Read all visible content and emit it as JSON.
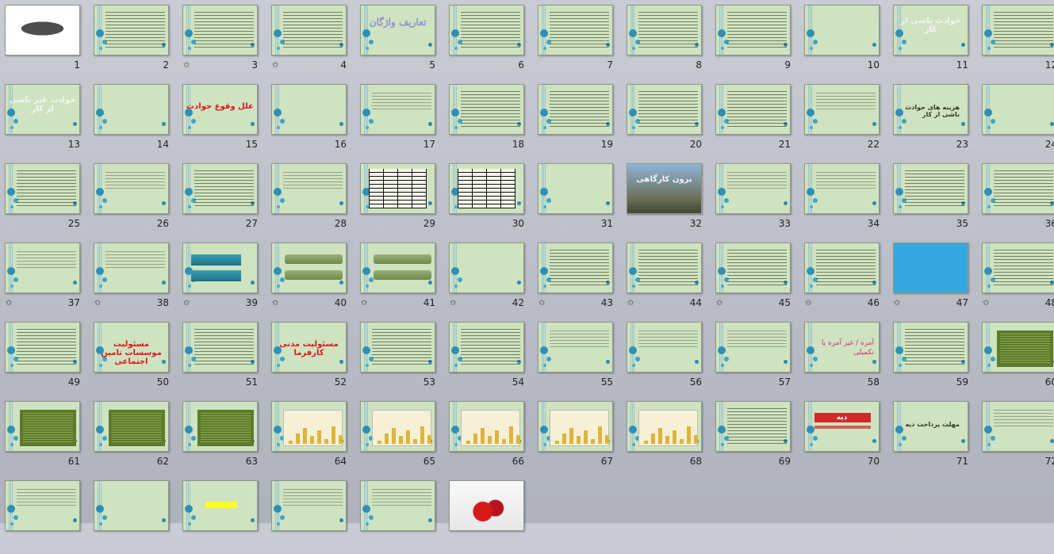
{
  "slides": [
    {
      "n": "1",
      "star": "",
      "v": "cal"
    },
    {
      "n": "2",
      "star": "",
      "v": "lines"
    },
    {
      "n": "3",
      "star": "✩",
      "v": "lines"
    },
    {
      "n": "4",
      "star": "✩",
      "v": "lines"
    },
    {
      "n": "5",
      "star": "",
      "v": "title",
      "title": "تعاریف واژگان"
    },
    {
      "n": "6",
      "star": "",
      "v": "lines"
    },
    {
      "n": "7",
      "star": "",
      "v": "lines"
    },
    {
      "n": "8",
      "star": "",
      "v": "lines"
    },
    {
      "n": "9",
      "star": "",
      "v": "lines"
    },
    {
      "n": "10",
      "star": "",
      "v": "plain"
    },
    {
      "n": "11",
      "star": "",
      "v": "white",
      "title": "حوادث ناشی از کار"
    },
    {
      "n": "12",
      "star": "",
      "v": "lines"
    },
    {
      "n": "13",
      "star": "",
      "v": "white",
      "title": "حوادث غیر ناشی از کار"
    },
    {
      "n": "14",
      "star": "",
      "v": "plain"
    },
    {
      "n": "15",
      "star": "",
      "v": "red",
      "title": "علل وقوع حوادث"
    },
    {
      "n": "16",
      "star": "",
      "v": "plain"
    },
    {
      "n": "17",
      "star": "",
      "v": "sparse"
    },
    {
      "n": "18",
      "star": "",
      "v": "lines"
    },
    {
      "n": "19",
      "star": "",
      "v": "lines"
    },
    {
      "n": "20",
      "star": "",
      "v": "lines"
    },
    {
      "n": "21",
      "star": "",
      "v": "lines"
    },
    {
      "n": "22",
      "star": "",
      "v": "sparse"
    },
    {
      "n": "23",
      "star": "",
      "v": "dark",
      "title": "هزینه های حوادث ناشی از کار"
    },
    {
      "n": "24",
      "star": "",
      "v": "plain"
    },
    {
      "n": "25",
      "star": "",
      "v": "lines"
    },
    {
      "n": "26",
      "star": "",
      "v": "sparse"
    },
    {
      "n": "27",
      "star": "",
      "v": "lines"
    },
    {
      "n": "28",
      "star": "",
      "v": "sparse"
    },
    {
      "n": "29",
      "star": "",
      "v": "table"
    },
    {
      "n": "30",
      "star": "",
      "v": "table"
    },
    {
      "n": "31",
      "star": "",
      "v": "plain"
    },
    {
      "n": "32",
      "star": "",
      "v": "pic",
      "title": "برون کارگاهی"
    },
    {
      "n": "33",
      "star": "",
      "v": "sparse"
    },
    {
      "n": "34",
      "star": "",
      "v": "sparse"
    },
    {
      "n": "35",
      "star": "",
      "v": "lines"
    },
    {
      "n": "36",
      "star": "",
      "v": "lines"
    },
    {
      "n": "37",
      "star": "✩",
      "v": "sparse"
    },
    {
      "n": "38",
      "star": "✩",
      "v": "sparse"
    },
    {
      "n": "39",
      "star": "✩",
      "v": "teal"
    },
    {
      "n": "40",
      "star": "✩",
      "v": "pills"
    },
    {
      "n": "41",
      "star": "✩",
      "v": "pills"
    },
    {
      "n": "42",
      "star": "✩",
      "v": "plain"
    },
    {
      "n": "43",
      "star": "✩",
      "v": "lines"
    },
    {
      "n": "44",
      "star": "✩",
      "v": "lines"
    },
    {
      "n": "45",
      "star": "✩",
      "v": "lines"
    },
    {
      "n": "46",
      "star": "✩",
      "v": "lines"
    },
    {
      "n": "47",
      "star": "✩",
      "v": "blue"
    },
    {
      "n": "48",
      "star": "✩",
      "v": "lines"
    },
    {
      "n": "49",
      "star": "",
      "v": "lines"
    },
    {
      "n": "50",
      "star": "",
      "v": "red",
      "title": "مسئولیت موسسات تامین اجتماعی"
    },
    {
      "n": "51",
      "star": "",
      "v": "lines"
    },
    {
      "n": "52",
      "star": "",
      "v": "red",
      "title": "مسئولیت مدنی کارفرما"
    },
    {
      "n": "53",
      "star": "",
      "v": "lines"
    },
    {
      "n": "54",
      "star": "",
      "v": "lines"
    },
    {
      "n": "55",
      "star": "",
      "v": "sparse"
    },
    {
      "n": "56",
      "star": "",
      "v": "sparse"
    },
    {
      "n": "57",
      "star": "",
      "v": "sparse"
    },
    {
      "n": "58",
      "star": "",
      "v": "pink",
      "title": "آمره / غیر آمره یا تکمیلی"
    },
    {
      "n": "59",
      "star": "",
      "v": "lines"
    },
    {
      "n": "60",
      "star": "",
      "v": "darkpanel"
    },
    {
      "n": "61",
      "star": "",
      "v": "darkpanel"
    },
    {
      "n": "62",
      "star": "",
      "v": "darkpanel"
    },
    {
      "n": "63",
      "star": "",
      "v": "darkpanel"
    },
    {
      "n": "64",
      "star": "",
      "v": "chart"
    },
    {
      "n": "65",
      "star": "",
      "v": "chart"
    },
    {
      "n": "66",
      "star": "",
      "v": "chart"
    },
    {
      "n": "67",
      "star": "",
      "v": "chart"
    },
    {
      "n": "68",
      "star": "",
      "v": "chart"
    },
    {
      "n": "69",
      "star": "",
      "v": "lines"
    },
    {
      "n": "70",
      "star": "",
      "v": "redbox",
      "title": "دیه"
    },
    {
      "n": "71",
      "star": "",
      "v": "dark",
      "title": "مهلت پرداخت دیه"
    },
    {
      "n": "72",
      "star": "",
      "v": "sparse"
    },
    {
      "n": "",
      "star": "",
      "v": "sparse"
    },
    {
      "n": "",
      "star": "",
      "v": "plain"
    },
    {
      "n": "",
      "star": "",
      "v": "yellow"
    },
    {
      "n": "",
      "star": "",
      "v": "sparse"
    },
    {
      "n": "",
      "star": "",
      "v": "sparse"
    },
    {
      "n": "",
      "star": "",
      "v": "rose"
    }
  ]
}
